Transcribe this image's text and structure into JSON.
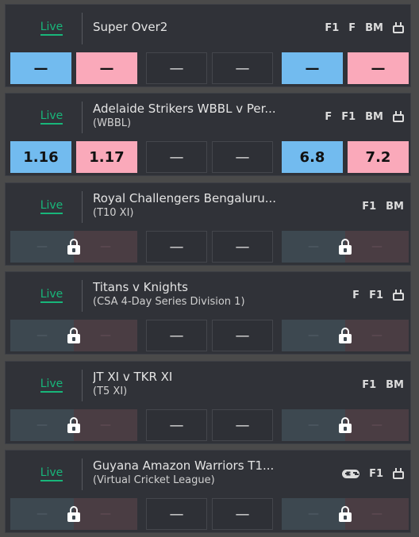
{
  "colors": {
    "back": "#72bbef",
    "lay": "#faa9ba",
    "live": "#18b67a",
    "card_bg": "#303238",
    "page_bg": "#4a4a4a"
  },
  "events": [
    {
      "live_label": "Live",
      "title": "Super Over2",
      "subtitle": "",
      "badges": [
        "F1",
        "F",
        "BM",
        "tv-icon"
      ],
      "suspended": false,
      "odds": [
        "—",
        "—",
        "—",
        "—",
        "—",
        "—"
      ]
    },
    {
      "live_label": "Live",
      "title": "Adelaide Strikers WBBL v Per...",
      "subtitle": "(WBBL)",
      "badges": [
        "F",
        "F1",
        "BM",
        "tv-icon"
      ],
      "suspended": false,
      "odds": [
        "1.16",
        "1.17",
        "—",
        "—",
        "6.8",
        "7.2"
      ]
    },
    {
      "live_label": "Live",
      "title": "Royal Challengers Bengaluru...",
      "subtitle": "(T10 XI)",
      "badges": [
        "F1",
        "BM"
      ],
      "suspended": true,
      "odds": [
        "—",
        "—",
        "—",
        "—",
        "—",
        "—"
      ]
    },
    {
      "live_label": "Live",
      "title": "Titans v Knights",
      "subtitle": "(CSA 4-Day Series Division 1)",
      "badges": [
        "F",
        "F1",
        "tv-icon"
      ],
      "suspended": true,
      "odds": [
        "—",
        "—",
        "—",
        "—",
        "—",
        "—"
      ]
    },
    {
      "live_label": "Live",
      "title": "JT XI v TKR XI",
      "subtitle": "(T5 XI)",
      "badges": [
        "F1",
        "BM"
      ],
      "suspended": true,
      "odds": [
        "—",
        "—",
        "—",
        "—",
        "—",
        "—"
      ]
    },
    {
      "live_label": "Live",
      "title": "Guyana Amazon Warriors T1...",
      "subtitle": "(Virtual Cricket League)",
      "badges": [
        "gamepad-icon",
        "F1",
        "tv-icon"
      ],
      "suspended": true,
      "odds": [
        "—",
        "—",
        "—",
        "—",
        "—",
        "—"
      ]
    }
  ]
}
